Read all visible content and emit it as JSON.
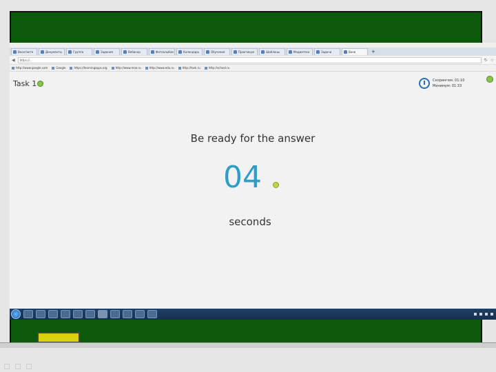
{
  "task": {
    "title": "Task 1"
  },
  "status": {
    "line1": "Скорингем: 01:10",
    "line2": "Минимум: 01:33"
  },
  "prompt": {
    "text": "Be ready for the answer"
  },
  "countdown": {
    "value": "04",
    "unit": "seconds"
  },
  "browser": {
    "url": "https://...",
    "active_tab": "Воно",
    "tabs": [
      "Вконтакте",
      "Документы",
      "Группа",
      "Задания",
      "Вебинар",
      "Фотоальбом",
      "Календарь",
      "Обучение",
      "Практикум",
      "Шаблоны",
      "Медиатека",
      "Задачи"
    ],
    "bookmarks": [
      "http://www.google.com",
      "Google",
      "https://learningapps.org",
      "http://www.moo.ru",
      "http://www.edu.ru",
      "http://task.ru",
      "http://school.ru"
    ]
  },
  "colors": {
    "accent": "#2f9ec7",
    "board": "#0b5a0b",
    "highlight": "#d9d10e"
  },
  "icons": {
    "gem": "gem-icon",
    "clock": "clock-icon"
  }
}
